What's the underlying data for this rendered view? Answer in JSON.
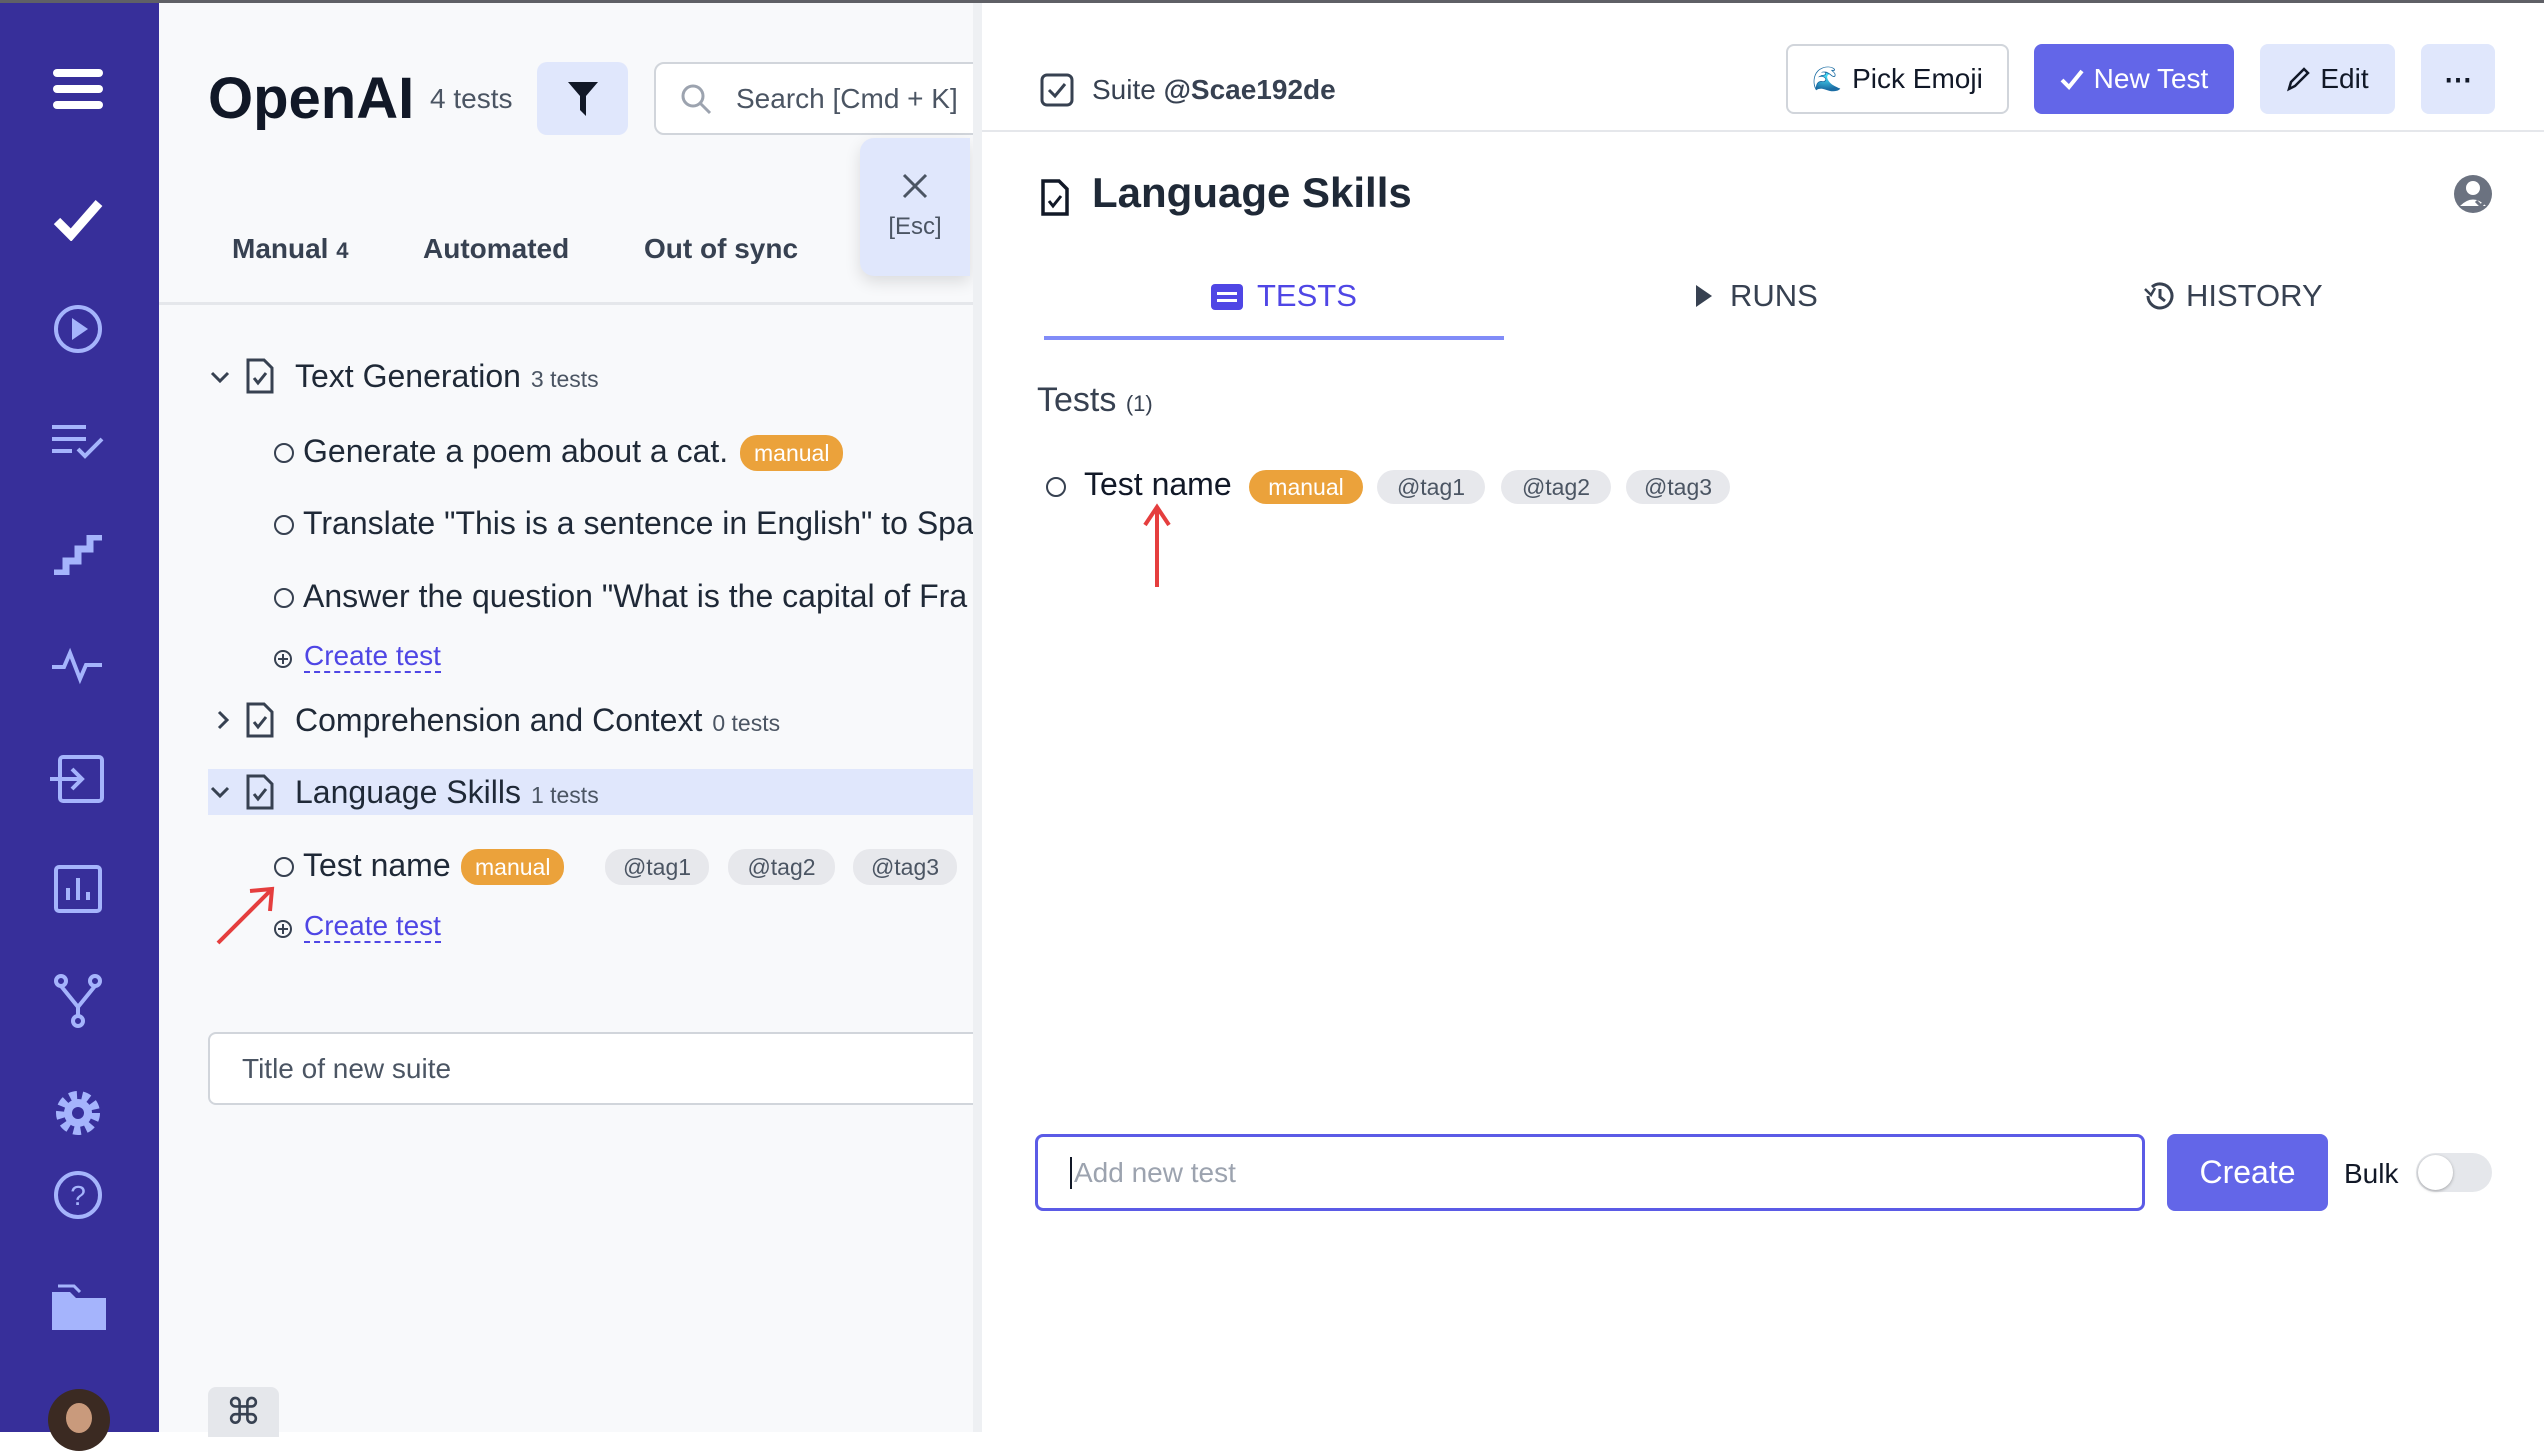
{
  "sidebar": {
    "icons": [
      "menu-icon",
      "check-icon",
      "play-circle-icon",
      "list-check-icon",
      "steps-icon",
      "pulse-icon",
      "import-icon",
      "chart-icon",
      "branch-icon",
      "gear-icon",
      "help-icon",
      "folder-icon",
      "avatar"
    ]
  },
  "left": {
    "project_title": "OpenAI",
    "test_count": "4 tests",
    "search_placeholder": "Search [Cmd + K]",
    "close_label": "[Esc]",
    "tabs": [
      {
        "label": "Manual",
        "count": "4"
      },
      {
        "label": "Automated"
      },
      {
        "label": "Out of sync"
      }
    ],
    "suites": [
      {
        "name": "Text Generation",
        "count": "3 tests",
        "expanded": true,
        "tests": [
          {
            "name": "Generate a poem about a cat.",
            "badge": "manual"
          },
          {
            "name": "Translate \"This is a sentence in English\" to Spa"
          },
          {
            "name": "Answer the question \"What is the capital of Fra"
          }
        ],
        "create": "Create test"
      },
      {
        "name": "Comprehension and Context",
        "count": "0 tests",
        "expanded": false
      },
      {
        "name": "Language Skills",
        "count": "1 tests",
        "expanded": true,
        "selected": true,
        "tests": [
          {
            "name": "Test name",
            "badge": "manual",
            "tags": [
              "@tag1",
              "@tag2",
              "@tag3"
            ]
          }
        ],
        "create": "Create test"
      }
    ],
    "new_suite_placeholder": "Title of new suite",
    "cmd_icon": "command-icon"
  },
  "right": {
    "suite_label": "Suite",
    "suite_id": "@Scae192de",
    "buttons": {
      "pick_emoji": "Pick Emoji",
      "new_test": "New Test",
      "edit": "Edit",
      "more": "⋯"
    },
    "title": "Language Skills",
    "tabs": [
      {
        "label": "TESTS",
        "active": true
      },
      {
        "label": "RUNS"
      },
      {
        "label": "HISTORY"
      }
    ],
    "tests_heading": "Tests",
    "tests_count": "(1)",
    "test": {
      "name": "Test name",
      "badge": "manual",
      "tags": [
        "@tag1",
        "@tag2",
        "@tag3"
      ]
    },
    "add_placeholder": "Add new test",
    "create": "Create",
    "bulk": "Bulk",
    "bulk_on": false
  },
  "colors": {
    "sidebar": "#372f9a",
    "accent": "#6366e8",
    "manual": "#eba23b",
    "annotation": "#e53e3e"
  }
}
